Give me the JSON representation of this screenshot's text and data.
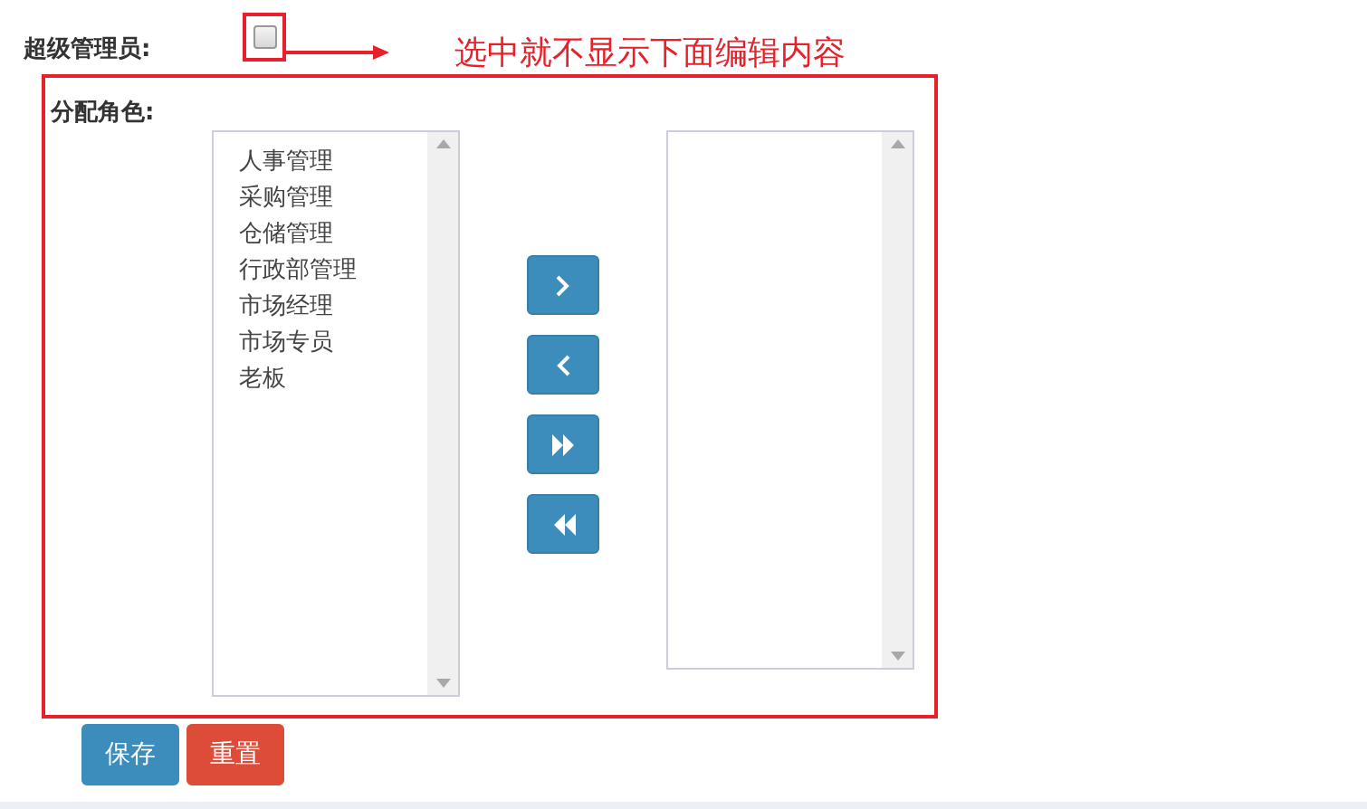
{
  "super_admin": {
    "label": "超级管理员:",
    "checked": false
  },
  "annotation": "选中就不显示下面编辑内容",
  "roles": {
    "label": "分配角色:",
    "available": [
      {
        "label": "人事管理"
      },
      {
        "label": "采购管理"
      },
      {
        "label": "仓储管理"
      },
      {
        "label": "行政部管理"
      },
      {
        "label": "市场经理"
      },
      {
        "label": "市场专员"
      },
      {
        "label": "老板"
      }
    ],
    "move_buttons": [
      {
        "kind": "move-right"
      },
      {
        "kind": "move-left"
      },
      {
        "kind": "move-all-right"
      },
      {
        "kind": "move-all-left"
      }
    ]
  },
  "buttons": [
    {
      "label": "保存",
      "kind": "primary"
    },
    {
      "label": "重置",
      "kind": "danger"
    }
  ]
}
